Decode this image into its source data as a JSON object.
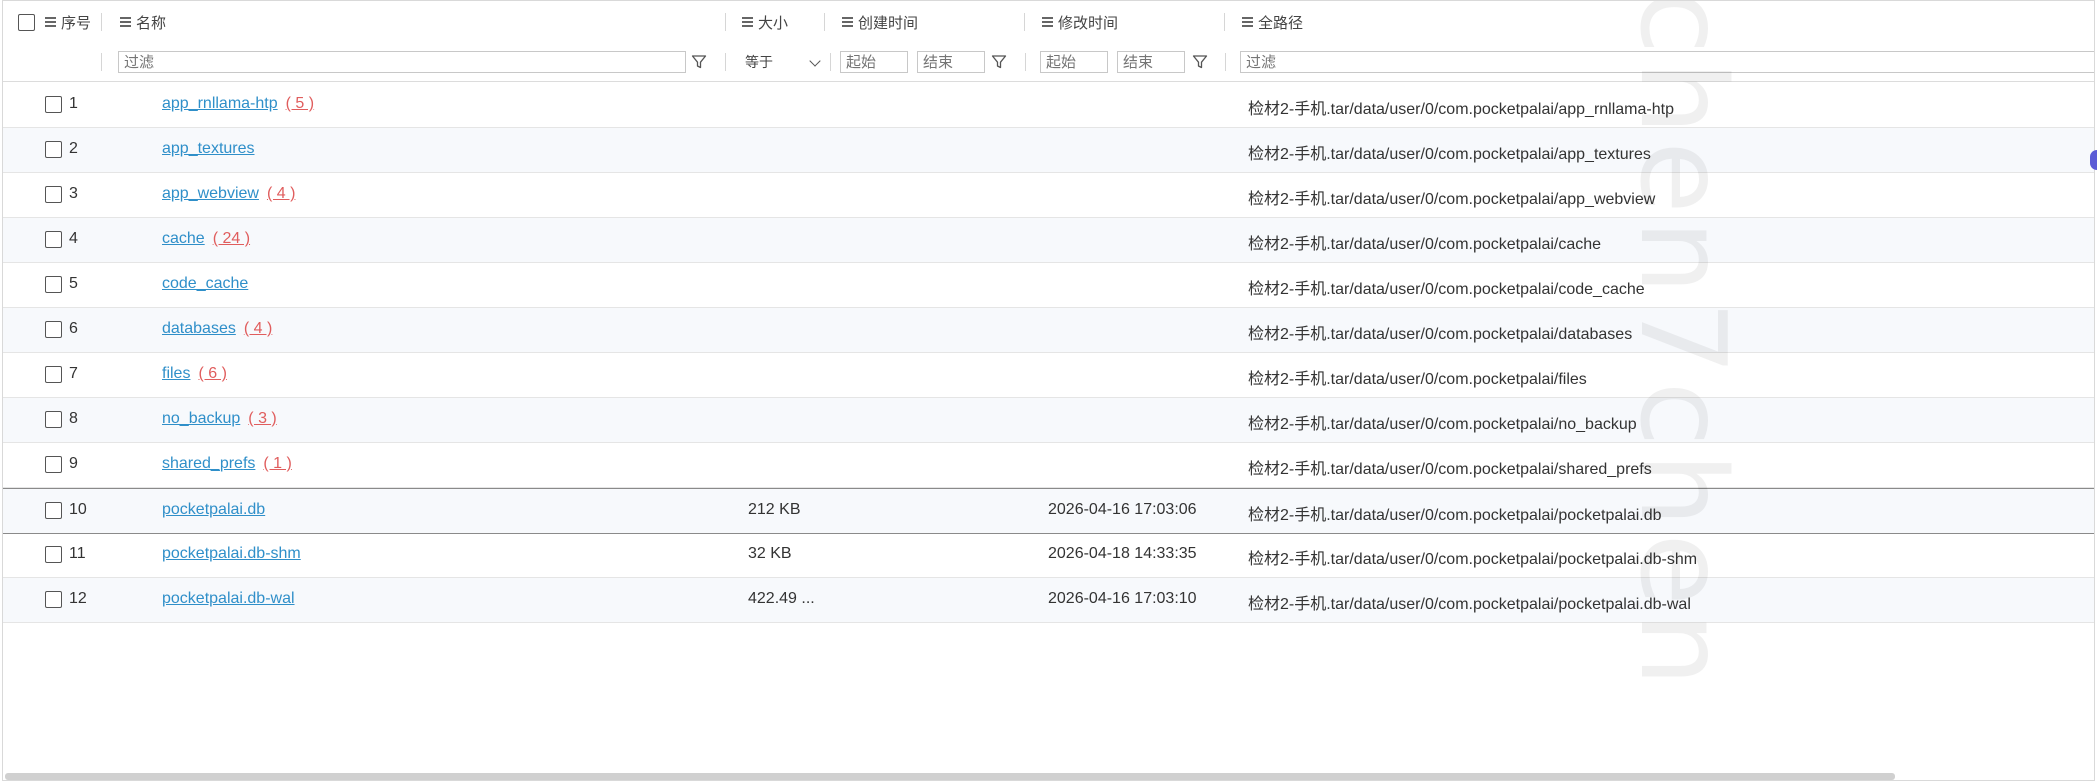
{
  "columns": {
    "seq": "序号",
    "name": "名称",
    "size": "大小",
    "created": "创建时间",
    "modified": "修改时间",
    "path": "全路径"
  },
  "filters": {
    "name_placeholder": "过滤",
    "size_operator": "等于",
    "created_start": "起始",
    "created_end": "结束",
    "modified_start": "起始",
    "modified_end": "结束",
    "path_placeholder": "过滤"
  },
  "rows": [
    {
      "seq": "1",
      "name": "app_rnllama-htp",
      "count": "( 5 )",
      "size": "",
      "modified": "",
      "path": "检材2-手机.tar/data/user/0/com.pocketpalai/app_rnllama-htp"
    },
    {
      "seq": "2",
      "name": "app_textures",
      "count": "",
      "size": "",
      "modified": "",
      "path": "检材2-手机.tar/data/user/0/com.pocketpalai/app_textures"
    },
    {
      "seq": "3",
      "name": "app_webview",
      "count": "( 4 )",
      "size": "",
      "modified": "",
      "path": "检材2-手机.tar/data/user/0/com.pocketpalai/app_webview"
    },
    {
      "seq": "4",
      "name": "cache",
      "count": "( 24 )",
      "size": "",
      "modified": "",
      "path": "检材2-手机.tar/data/user/0/com.pocketpalai/cache"
    },
    {
      "seq": "5",
      "name": "code_cache",
      "count": "",
      "size": "",
      "modified": "",
      "path": "检材2-手机.tar/data/user/0/com.pocketpalai/code_cache"
    },
    {
      "seq": "6",
      "name": "databases",
      "count": "( 4 )",
      "size": "",
      "modified": "",
      "path": "检材2-手机.tar/data/user/0/com.pocketpalai/databases"
    },
    {
      "seq": "7",
      "name": "files",
      "count": "( 6 )",
      "size": "",
      "modified": "",
      "path": "检材2-手机.tar/data/user/0/com.pocketpalai/files"
    },
    {
      "seq": "8",
      "name": "no_backup",
      "count": "( 3 )",
      "size": "",
      "modified": "",
      "path": "检材2-手机.tar/data/user/0/com.pocketpalai/no_backup"
    },
    {
      "seq": "9",
      "name": "shared_prefs",
      "count": "( 1 )",
      "size": "",
      "modified": "",
      "path": "检材2-手机.tar/data/user/0/com.pocketpalai/shared_prefs"
    },
    {
      "seq": "10",
      "name": "pocketpalai.db",
      "count": "",
      "size": "212 KB",
      "modified": "2026-04-16 17:03:06",
      "path": "检材2-手机.tar/data/user/0/com.pocketpalai/pocketpalai.db"
    },
    {
      "seq": "11",
      "name": "pocketpalai.db-shm",
      "count": "",
      "size": "32 KB",
      "modified": "2026-04-18 14:33:35",
      "path": "检材2-手机.tar/data/user/0/com.pocketpalai/pocketpalai.db-shm"
    },
    {
      "seq": "12",
      "name": "pocketpalai.db-wal",
      "count": "",
      "size": "422.49 ...",
      "modified": "2026-04-16 17:03:10",
      "path": "检材2-手机.tar/data/user/0/com.pocketpalai/pocketpalai.db-wal"
    }
  ],
  "watermark": "chen7chen",
  "colors": {
    "link": "#2f8fc9",
    "count": "#e05d5d",
    "alt_row": "#f7f9fc"
  }
}
